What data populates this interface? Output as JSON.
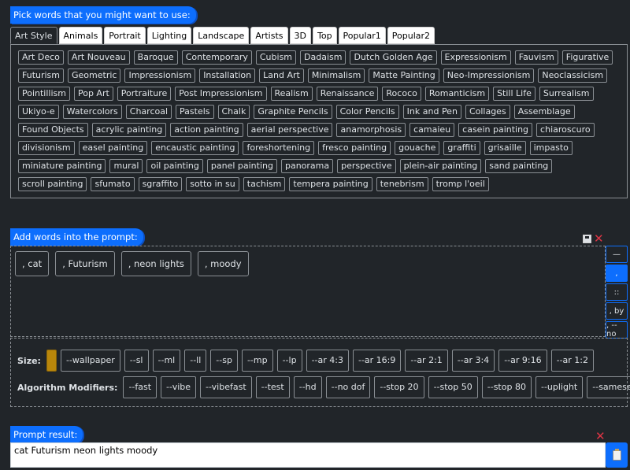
{
  "labels": {
    "pick_words": "Pick words that you might want to use:",
    "add_words": "Add words into the prompt:",
    "prompt_result": "Prompt result:"
  },
  "tabs": [
    {
      "label": "Art Style",
      "active": true
    },
    {
      "label": "Animals"
    },
    {
      "label": "Portrait"
    },
    {
      "label": "Lighting"
    },
    {
      "label": "Landscape"
    },
    {
      "label": "Artists"
    },
    {
      "label": "3D"
    },
    {
      "label": "Top"
    },
    {
      "label": "Popular1"
    },
    {
      "label": "Popular2"
    }
  ],
  "words": [
    "Art Deco",
    "Art Nouveau",
    "Baroque",
    "Contemporary",
    "Cubism",
    "Dadaism",
    "Dutch Golden Age",
    "Expressionism",
    "Fauvism",
    "Figurative",
    "Futurism",
    "Geometric",
    "Impressionism",
    "Installation",
    "Land Art",
    "Minimalism",
    "Matte Painting",
    "Neo-Impressionism",
    "Neoclassicism",
    "Pointillism",
    "Pop Art",
    "Portraiture",
    "Post Impressionism",
    "Realism",
    "Renaissance",
    "Rococo",
    "Romanticism",
    "Still Life",
    "Surrealism",
    "Ukiyo-e",
    "Watercolors",
    "Charcoal",
    "Pastels",
    "Chalk",
    "Graphite Pencils",
    "Color Pencils",
    "Ink and Pen",
    "Collages",
    "Assemblage",
    "Found Objects",
    "acrylic painting",
    "action painting",
    "aerial perspective",
    "anamorphosis",
    "camaieu",
    "casein painting",
    "chiaroscuro",
    "divisionism",
    "easel painting",
    "encaustic painting",
    "foreshortening",
    "fresco painting",
    "gouache",
    "graffiti",
    "grisaille",
    "impasto",
    "miniature painting",
    "mural",
    "oil painting",
    "panel painting",
    "panorama",
    "perspective",
    "plein-air painting",
    "sand painting",
    "scroll painting",
    "sfumato",
    "sgraffito",
    "sotto in su",
    "tachism",
    "tempera painting",
    "tenebrism",
    "tromp l'oeil"
  ],
  "prompt_words": [
    ", cat",
    ", Futurism",
    ", neon lights",
    ", moody"
  ],
  "separators": [
    {
      "label": "—",
      "active": false
    },
    {
      "label": ",",
      "active": true
    },
    {
      "label": "::",
      "active": false
    },
    {
      "label": ", by",
      "active": false
    },
    {
      "label": ", --no",
      "active": false
    }
  ],
  "size": {
    "label": "Size:",
    "swatch_color": "#b8860b",
    "options": [
      "--wallpaper",
      "--sl",
      "--ml",
      "--ll",
      "--sp",
      "--mp",
      "--lp",
      "--ar 4:3",
      "--ar 16:9",
      "--ar 2:1",
      "--ar 3:4",
      "--ar 9:16",
      "--ar 1:2"
    ]
  },
  "algorithm": {
    "label": "Algorithm Modifiers:",
    "options": [
      "--fast",
      "--vibe",
      "--vibefast",
      "--test",
      "--hd",
      "--no dof",
      "--stop 20",
      "--stop 50",
      "--stop 80",
      "--uplight",
      "--sameseed"
    ]
  },
  "result": {
    "text": "cat Futurism neon lights moody"
  },
  "icons": {
    "save": "save-icon",
    "clear": "close-icon",
    "copy": "clipboard-icon"
  },
  "colors": {
    "accent": "#0d6efd",
    "background": "#212529",
    "danger": "#dc3545"
  }
}
